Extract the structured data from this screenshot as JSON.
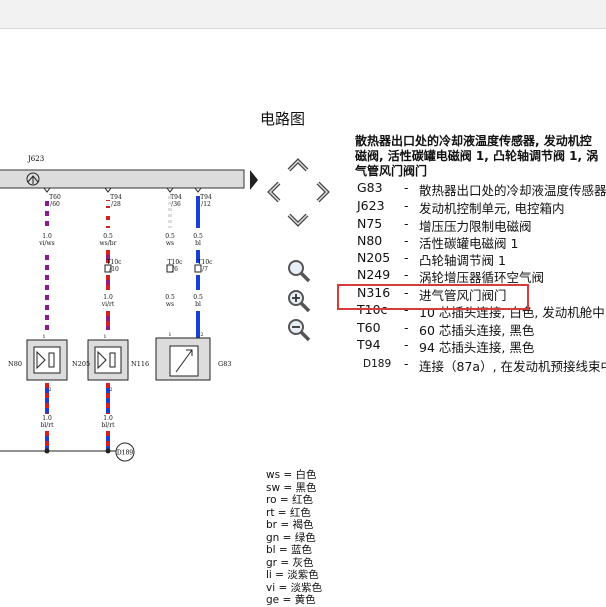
{
  "title": "电路图",
  "legend_heading_lines": [
    "散热器出口处的冷却液温度传感器, 发动机控",
    "磁阀, 活性碳罐电磁阀 1, 凸轮轴调节阀 1, 涡",
    "气管风门阀门"
  ],
  "legend": [
    {
      "code": "G83",
      "desc": "散热器出口处的冷却液温度传感器"
    },
    {
      "code": "J623",
      "desc": "发动机控制单元, 电控箱内"
    },
    {
      "code": "N75",
      "desc": "增压压力限制电磁阀"
    },
    {
      "code": "N80",
      "desc": "活性碳罐电磁阀 1"
    },
    {
      "code": "N205",
      "desc": "凸轮轴调节阀 1"
    },
    {
      "code": "N249",
      "desc": "涡轮增压器循环空气阀"
    },
    {
      "code": "N316",
      "desc": "进气管风门阀门"
    },
    {
      "code": "T10c",
      "desc": "10 芯插头连接, 白色, 发动机舱中"
    },
    {
      "code": "T60",
      "desc": "60 芯插头连接, 黑色"
    },
    {
      "code": "T94",
      "desc": "94 芯插头连接, 黑色"
    },
    {
      "code": "D189",
      "desc": "连接（87a）, 在发动机预接线束中"
    }
  ],
  "color_key": [
    {
      "abbr": "ws",
      "name": "白色"
    },
    {
      "abbr": "sw",
      "name": "黑色"
    },
    {
      "abbr": "ro",
      "name": "红色"
    },
    {
      "abbr": "rt",
      "name": "红色"
    },
    {
      "abbr": "br",
      "name": "褐色"
    },
    {
      "abbr": "gn",
      "name": "绿色"
    },
    {
      "abbr": "bl",
      "name": "蓝色"
    },
    {
      "abbr": "gr",
      "name": "灰色"
    },
    {
      "abbr": "li",
      "name": "淡紫色"
    },
    {
      "abbr": "vi",
      "name": "淡紫色"
    },
    {
      "abbr": "ge",
      "name": "黄色"
    }
  ],
  "diagram": {
    "control_unit": "J623",
    "wires": [
      {
        "pin": "T60\n/60",
        "size": "1.0",
        "color": "vi/ws",
        "conn": "",
        "size2": "",
        "color2": "",
        "size3": "1.0",
        "color3": "bl/rt"
      },
      {
        "pin": "T94\n/28",
        "size": "0.5",
        "color": "ws/br",
        "conn": "T10c\n/10",
        "size2": "1.0",
        "color2": "vi/rt",
        "size3": "1.0",
        "color3": "bl/rt"
      },
      {
        "pin": "T94\n/36",
        "size": "0.5",
        "color": "ws",
        "conn": "T10c\n/6",
        "size2": "0.5",
        "color2": "ws",
        "size3": "",
        "color3": ""
      },
      {
        "pin": "T94\n/12",
        "size": "0.5",
        "color": "bl",
        "conn": "T10c\n/7",
        "size2": "0.5",
        "color2": "bl",
        "size3": "",
        "color3": ""
      }
    ],
    "components": [
      "N80",
      "N205",
      "N116",
      "G83"
    ],
    "connection_point": "D189"
  },
  "colors": {
    "highlight": "#d93a3a",
    "violet": "#8b1c8b",
    "red": "#d42020",
    "blue": "#1a3fd6",
    "component_fill": "#dcdcdc"
  },
  "nav_icons": [
    "chevron-up-icon",
    "chevron-left-icon",
    "chevron-right-icon",
    "chevron-down-icon",
    "magnifier-icon",
    "zoom-in-icon",
    "zoom-out-icon"
  ]
}
